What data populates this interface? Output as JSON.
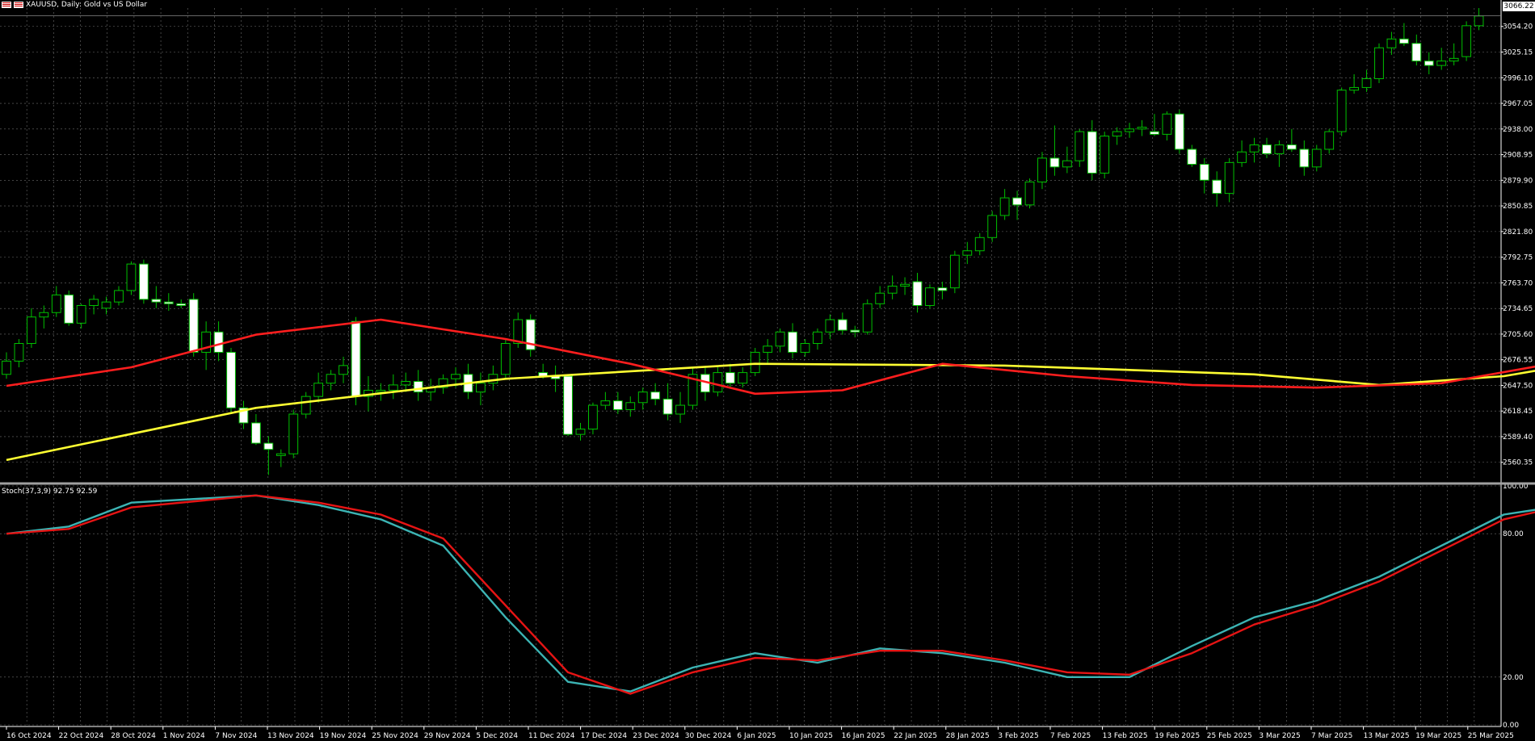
{
  "header": {
    "title": "XAUUSD, Daily:  Gold vs US Dollar"
  },
  "indicator": {
    "label": "Stoch(37,3,9) 92.75 92.59"
  },
  "price_tag": "3066.22",
  "colors": {
    "background": "#000000",
    "grid": "#c8c8c8",
    "candle_bull": "#000000",
    "candle_bear": "#ffffff",
    "wick": "#00c000",
    "ma_fast": "#ff1e1e",
    "ma_slow": "#ffff32",
    "stoch_main": "#3cb4b4",
    "stoch_signal": "#e61414",
    "separator": "#a0a0a0"
  },
  "chart_data": [
    {
      "type": "candlestick",
      "series_name": "XAUUSD",
      "y_ticks": [
        "3054.20",
        "3025.15",
        "2996.10",
        "2967.05",
        "2938.00",
        "2908.95",
        "2879.90",
        "2850.85",
        "2821.80",
        "2792.75",
        "2763.70",
        "2734.65",
        "2705.60",
        "2676.55",
        "2647.50",
        "2618.45",
        "2589.40",
        "2560.35"
      ],
      "ylim": [
        2540,
        3075
      ],
      "x_labels": [
        "16 Oct 2024",
        "22 Oct 2024",
        "28 Oct 2024",
        "1 Nov 2024",
        "7 Nov 2024",
        "13 Nov 2024",
        "19 Nov 2024",
        "25 Nov 2024",
        "29 Nov 2024",
        "5 Dec 2024",
        "11 Dec 2024",
        "17 Dec 2024",
        "23 Dec 2024",
        "30 Dec 2024",
        "6 Jan 2025",
        "10 Jan 2025",
        "16 Jan 2025",
        "22 Jan 2025",
        "28 Jan 2025",
        "3 Feb 2025",
        "7 Feb 2025",
        "13 Feb 2025",
        "19 Feb 2025",
        "25 Feb 2025",
        "3 Mar 2025",
        "7 Mar 2025",
        "13 Mar 2025",
        "19 Mar 2025",
        "25 Mar 2025"
      ],
      "ohlc": [
        [
          2660,
          2685,
          2655,
          2675
        ],
        [
          2675,
          2700,
          2668,
          2695
        ],
        [
          2695,
          2735,
          2690,
          2725
        ],
        [
          2725,
          2738,
          2712,
          2730
        ],
        [
          2730,
          2760,
          2725,
          2750
        ],
        [
          2750,
          2755,
          2715,
          2718
        ],
        [
          2718,
          2740,
          2712,
          2738
        ],
        [
          2738,
          2750,
          2728,
          2745
        ],
        [
          2735,
          2748,
          2728,
          2742
        ],
        [
          2742,
          2760,
          2738,
          2755
        ],
        [
          2755,
          2788,
          2750,
          2785
        ],
        [
          2785,
          2790,
          2740,
          2745
        ],
        [
          2745,
          2760,
          2735,
          2742
        ],
        [
          2742,
          2752,
          2732,
          2740
        ],
        [
          2740,
          2745,
          2735,
          2738
        ],
        [
          2745,
          2752,
          2680,
          2685
        ],
        [
          2685,
          2720,
          2665,
          2708
        ],
        [
          2708,
          2720,
          2675,
          2685
        ],
        [
          2685,
          2690,
          2615,
          2622
        ],
        [
          2622,
          2630,
          2598,
          2605
        ],
        [
          2605,
          2615,
          2580,
          2582
        ],
        [
          2582,
          2590,
          2546,
          2575
        ],
        [
          2568,
          2575,
          2555,
          2570
        ],
        [
          2570,
          2620,
          2565,
          2615
        ],
        [
          2615,
          2640,
          2610,
          2635
        ],
        [
          2635,
          2662,
          2628,
          2650
        ],
        [
          2650,
          2665,
          2642,
          2660
        ],
        [
          2660,
          2680,
          2650,
          2670
        ],
        [
          2720,
          2725,
          2625,
          2635
        ],
        [
          2635,
          2658,
          2618,
          2642
        ],
        [
          2640,
          2650,
          2630,
          2642
        ],
        [
          2642,
          2660,
          2632,
          2648
        ],
        [
          2648,
          2662,
          2640,
          2652
        ],
        [
          2652,
          2665,
          2630,
          2640
        ],
        [
          2640,
          2655,
          2630,
          2645
        ],
        [
          2645,
          2660,
          2638,
          2655
        ],
        [
          2655,
          2668,
          2645,
          2660
        ],
        [
          2660,
          2672,
          2632,
          2640
        ],
        [
          2640,
          2662,
          2625,
          2650
        ],
        [
          2650,
          2670,
          2642,
          2660
        ],
        [
          2660,
          2700,
          2655,
          2695
        ],
        [
          2695,
          2730,
          2690,
          2722
        ],
        [
          2722,
          2728,
          2680,
          2688
        ],
        [
          2662,
          2672,
          2655,
          2658
        ],
        [
          2658,
          2670,
          2640,
          2655
        ],
        [
          2658,
          2660,
          2590,
          2592
        ],
        [
          2592,
          2605,
          2585,
          2598
        ],
        [
          2598,
          2628,
          2592,
          2625
        ],
        [
          2625,
          2640,
          2620,
          2630
        ],
        [
          2630,
          2640,
          2615,
          2620
        ],
        [
          2620,
          2635,
          2612,
          2628
        ],
        [
          2628,
          2645,
          2620,
          2640
        ],
        [
          2640,
          2650,
          2625,
          2632
        ],
        [
          2632,
          2650,
          2608,
          2615
        ],
        [
          2615,
          2640,
          2605,
          2625
        ],
        [
          2625,
          2668,
          2620,
          2660
        ],
        [
          2660,
          2668,
          2630,
          2640
        ],
        [
          2640,
          2668,
          2635,
          2662
        ],
        [
          2662,
          2672,
          2645,
          2650
        ],
        [
          2650,
          2668,
          2645,
          2662
        ],
        [
          2662,
          2690,
          2658,
          2685
        ],
        [
          2685,
          2700,
          2672,
          2692
        ],
        [
          2692,
          2712,
          2685,
          2708
        ],
        [
          2708,
          2718,
          2678,
          2685
        ],
        [
          2685,
          2700,
          2680,
          2695
        ],
        [
          2695,
          2712,
          2688,
          2708
        ],
        [
          2708,
          2728,
          2700,
          2722
        ],
        [
          2722,
          2730,
          2705,
          2710
        ],
        [
          2710,
          2715,
          2702,
          2708
        ],
        [
          2708,
          2745,
          2705,
          2740
        ],
        [
          2740,
          2760,
          2735,
          2752
        ],
        [
          2752,
          2772,
          2745,
          2760
        ],
        [
          2760,
          2770,
          2750,
          2762
        ],
        [
          2765,
          2775,
          2730,
          2738
        ],
        [
          2738,
          2762,
          2735,
          2758
        ],
        [
          2758,
          2765,
          2745,
          2755
        ],
        [
          2758,
          2800,
          2752,
          2795
        ],
        [
          2795,
          2810,
          2785,
          2800
        ],
        [
          2800,
          2820,
          2795,
          2815
        ],
        [
          2815,
          2845,
          2810,
          2840
        ],
        [
          2840,
          2870,
          2835,
          2860
        ],
        [
          2860,
          2868,
          2835,
          2852
        ],
        [
          2852,
          2882,
          2848,
          2878
        ],
        [
          2878,
          2912,
          2870,
          2905
        ],
        [
          2905,
          2942,
          2885,
          2895
        ],
        [
          2895,
          2918,
          2888,
          2902
        ],
        [
          2902,
          2938,
          2895,
          2935
        ],
        [
          2935,
          2948,
          2880,
          2888
        ],
        [
          2888,
          2935,
          2882,
          2930
        ],
        [
          2930,
          2940,
          2920,
          2935
        ],
        [
          2935,
          2945,
          2928,
          2938
        ],
        [
          2938,
          2948,
          2930,
          2940
        ],
        [
          2935,
          2955,
          2930,
          2932
        ],
        [
          2932,
          2958,
          2925,
          2955
        ],
        [
          2955,
          2960,
          2910,
          2915
        ],
        [
          2915,
          2920,
          2895,
          2898
        ],
        [
          2898,
          2905,
          2865,
          2880
        ],
        [
          2880,
          2890,
          2850,
          2865
        ],
        [
          2865,
          2905,
          2855,
          2900
        ],
        [
          2900,
          2925,
          2895,
          2912
        ],
        [
          2912,
          2928,
          2900,
          2920
        ],
        [
          2920,
          2928,
          2905,
          2910
        ],
        [
          2910,
          2925,
          2895,
          2920
        ],
        [
          2920,
          2938,
          2912,
          2915
        ],
        [
          2915,
          2925,
          2885,
          2895
        ],
        [
          2895,
          2920,
          2890,
          2915
        ],
        [
          2915,
          2938,
          2910,
          2935
        ],
        [
          2935,
          2985,
          2930,
          2982
        ],
        [
          2982,
          3000,
          2978,
          2985
        ],
        [
          2985,
          3005,
          2980,
          2995
        ],
        [
          2995,
          3035,
          2990,
          3030
        ],
        [
          3030,
          3048,
          3022,
          3040
        ],
        [
          3040,
          3058,
          3032,
          3035
        ],
        [
          3035,
          3045,
          3010,
          3015
        ],
        [
          3015,
          3025,
          3000,
          3010
        ],
        [
          3010,
          3030,
          3005,
          3015
        ],
        [
          3015,
          3035,
          3010,
          3018
        ],
        [
          3020,
          3060,
          3015,
          3055
        ],
        [
          3055,
          3075,
          3050,
          3066
        ]
      ],
      "ma_fast_points": [
        [
          0,
          2647
        ],
        [
          10,
          2668
        ],
        [
          20,
          2705
        ],
        [
          30,
          2722
        ],
        [
          40,
          2700
        ],
        [
          50,
          2672
        ],
        [
          60,
          2638
        ],
        [
          67,
          2642
        ],
        [
          75,
          2672
        ],
        [
          85,
          2658
        ],
        [
          95,
          2648
        ],
        [
          105,
          2645
        ],
        [
          115,
          2650
        ],
        [
          125,
          2675
        ],
        [
          135,
          2712
        ],
        [
          145,
          2775
        ],
        [
          155,
          2842
        ],
        [
          165,
          2890
        ],
        [
          175,
          2905
        ],
        [
          185,
          2920
        ],
        [
          195,
          2938
        ],
        [
          200,
          2955
        ],
        [
          207,
          2976
        ]
      ],
      "ma_slow_points": [
        [
          0,
          2563
        ],
        [
          20,
          2622
        ],
        [
          40,
          2655
        ],
        [
          60,
          2672
        ],
        [
          80,
          2670
        ],
        [
          100,
          2660
        ],
        [
          110,
          2648
        ],
        [
          120,
          2658
        ],
        [
          130,
          2682
        ],
        [
          150,
          2735
        ],
        [
          170,
          2780
        ],
        [
          180,
          2800
        ],
        [
          195,
          2860
        ],
        [
          207,
          2906
        ]
      ],
      "last_price": 3066.22
    },
    {
      "type": "line",
      "series_name": "Stoch(37,3,9)",
      "y_ticks": [
        "100.00",
        "80.00",
        "20.00",
        "0.00"
      ],
      "ylim": [
        0,
        100
      ],
      "main_points": [
        [
          0,
          80
        ],
        [
          5,
          83
        ],
        [
          10,
          93
        ],
        [
          20,
          96
        ],
        [
          25,
          92
        ],
        [
          30,
          86
        ],
        [
          35,
          75
        ],
        [
          40,
          45
        ],
        [
          45,
          18
        ],
        [
          50,
          14
        ],
        [
          55,
          24
        ],
        [
          60,
          30
        ],
        [
          65,
          26
        ],
        [
          70,
          32
        ],
        [
          75,
          30
        ],
        [
          80,
          26
        ],
        [
          85,
          20
        ],
        [
          90,
          20
        ],
        [
          95,
          33
        ],
        [
          100,
          45
        ],
        [
          105,
          52
        ],
        [
          110,
          62
        ],
        [
          115,
          75
        ],
        [
          120,
          88
        ],
        [
          125,
          92
        ],
        [
          130,
          94
        ],
        [
          135,
          95
        ],
        [
          140,
          96
        ],
        [
          145,
          95
        ],
        [
          150,
          93
        ],
        [
          155,
          95
        ],
        [
          160,
          94
        ],
        [
          165,
          90
        ],
        [
          170,
          87
        ],
        [
          175,
          82
        ],
        [
          180,
          80
        ],
        [
          185,
          86
        ],
        [
          190,
          92
        ],
        [
          195,
          96
        ],
        [
          200,
          94
        ],
        [
          205,
          93
        ]
      ],
      "signal_points": [
        [
          0,
          80
        ],
        [
          5,
          82
        ],
        [
          10,
          91
        ],
        [
          20,
          96
        ],
        [
          25,
          93
        ],
        [
          30,
          88
        ],
        [
          35,
          78
        ],
        [
          40,
          50
        ],
        [
          45,
          22
        ],
        [
          50,
          13
        ],
        [
          55,
          22
        ],
        [
          60,
          28
        ],
        [
          65,
          27
        ],
        [
          70,
          31
        ],
        [
          75,
          31
        ],
        [
          80,
          27
        ],
        [
          85,
          22
        ],
        [
          90,
          21
        ],
        [
          95,
          30
        ],
        [
          100,
          42
        ],
        [
          105,
          50
        ],
        [
          110,
          60
        ],
        [
          115,
          73
        ],
        [
          120,
          86
        ],
        [
          125,
          92
        ],
        [
          130,
          94
        ],
        [
          135,
          95
        ],
        [
          140,
          95
        ],
        [
          145,
          94
        ],
        [
          150,
          94
        ],
        [
          155,
          94
        ],
        [
          160,
          93
        ],
        [
          165,
          89
        ],
        [
          170,
          86
        ],
        [
          175,
          81
        ],
        [
          180,
          80
        ],
        [
          185,
          84
        ],
        [
          190,
          90
        ],
        [
          195,
          95
        ],
        [
          200,
          94
        ],
        [
          205,
          93
        ]
      ]
    }
  ]
}
